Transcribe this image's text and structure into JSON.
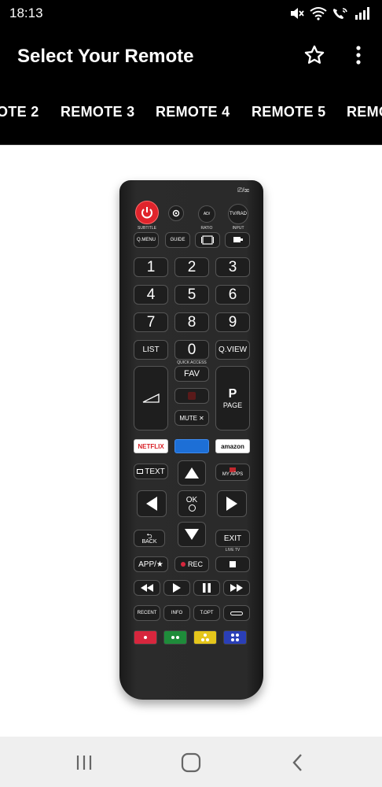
{
  "status": {
    "time": "18:13",
    "icons": [
      "mute-icon",
      "wifi-icon",
      "wifi-call-icon",
      "signal-icon"
    ]
  },
  "app_bar": {
    "title": "Select Your Remote",
    "star_icon": "star-outline-icon",
    "menu_icon": "more-vert-icon"
  },
  "tabs": [
    "OTE 2",
    "REMOTE 3",
    "REMOTE 4",
    "REMOTE 5",
    "REMO"
  ],
  "remote": {
    "top_indicator": "⎚/⌧",
    "labels": {
      "subtitle": "SUBTITLE",
      "ratio": "RATIO",
      "input": "INPUT",
      "quick_access": "QUICK ACCESS",
      "live_tv": "LIVE TV"
    },
    "buttons": {
      "tv_rad": "TV/RAD",
      "ad": "AD/",
      "q_menu": "Q.MENU",
      "guide": "GUIDE",
      "digits": [
        "1",
        "2",
        "3",
        "4",
        "5",
        "6",
        "7",
        "8",
        "9"
      ],
      "list": "LIST",
      "zero": "0",
      "q_view": "Q.VIEW",
      "fav": "FAV",
      "p": "P",
      "page": "PAGE",
      "mute": "MUTE",
      "netflix": "NETFLIX",
      "amazon": "amazon",
      "text": "TEXT",
      "my_apps": "MY APPS",
      "ok": "OK",
      "back": "BACK",
      "exit": "EXIT",
      "app": "APP/★",
      "rec": "REC",
      "recent": "RECENT",
      "info": "INFO",
      "t_opt": "T.OPT"
    },
    "colors": {
      "red": "#d7263d",
      "green": "#1e8c3a",
      "yellow": "#e5c61b",
      "blue": "#2a3fb8",
      "power": "#e0242c",
      "netflix": "#d81f26",
      "blue_key": "#1d6fd6"
    }
  },
  "nav": {
    "recents_icon": "recents-icon",
    "home_icon": "home-icon",
    "back_icon": "back-icon"
  }
}
